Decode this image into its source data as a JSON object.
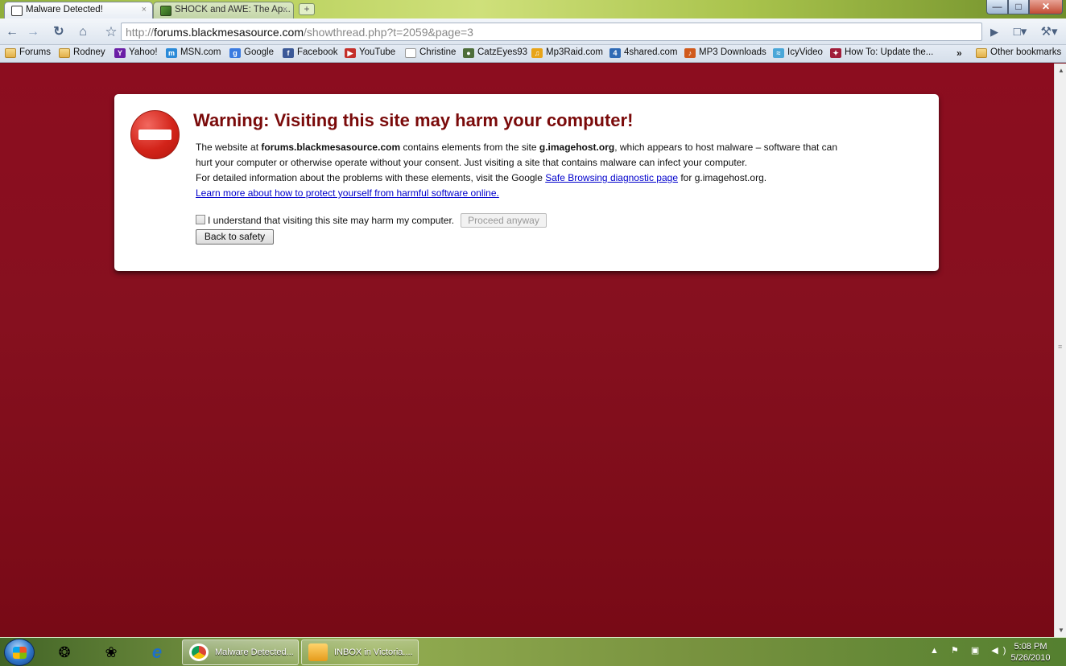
{
  "browser": {
    "tabs": [
      {
        "label": "Malware Detected!",
        "close": "×"
      },
      {
        "label": "SHOCK and AWE: The Ap...",
        "close": "×"
      }
    ],
    "new_tab": "+",
    "window_controls": {
      "minimize": "—",
      "maximize": "□",
      "close": "✕"
    },
    "url": {
      "scheme": "http://",
      "host": "forums.blackmesasource.com",
      "path": "/showthread.php?t=2059&page=3"
    },
    "icons": {
      "back": "back-arrow-icon",
      "forward": "forward-arrow-icon",
      "reload": "reload-icon",
      "home": "home-icon",
      "star": "star-icon",
      "go": "go-play-icon",
      "page": "page-menu-icon",
      "wrench": "wrench-icon"
    }
  },
  "bookmarks": [
    {
      "label": "Forums",
      "icon": "folder-icon"
    },
    {
      "label": "Rodney",
      "icon": "folder-icon"
    },
    {
      "label": "Yahoo!",
      "icon": "yahoo-icon"
    },
    {
      "label": "MSN.com",
      "icon": "msn-icon"
    },
    {
      "label": "Google",
      "icon": "google-icon"
    },
    {
      "label": "Facebook",
      "icon": "facebook-icon"
    },
    {
      "label": "YouTube",
      "icon": "youtube-icon"
    },
    {
      "label": "Christine",
      "icon": "page-icon"
    },
    {
      "label": "CatzEyes93",
      "icon": "cat-icon"
    },
    {
      "label": "Mp3Raid.com",
      "icon": "music-icon"
    },
    {
      "label": "4shared.com",
      "icon": "4shared-icon"
    },
    {
      "label": "MP3 Downloads",
      "icon": "mp3-icon"
    },
    {
      "label": "IcyVideo",
      "icon": "icyvideo-icon"
    },
    {
      "label": "How To: Update the...",
      "icon": "howto-icon"
    }
  ],
  "bookmarks_overflow": "»",
  "other_bookmarks": "Other bookmarks",
  "warning": {
    "title": "Warning: Visiting this site may harm your computer!",
    "line1_a": "The website at ",
    "line1_site": "forums.blackmesasource.com",
    "line1_b": " contains elements from the site ",
    "line1_host": "g.imagehost.org",
    "line1_c": ", which appears to host malware – software that can",
    "line2": "hurt your computer or otherwise operate without your consent. Just visiting a site that contains malware can infect your computer.",
    "line3_a": "For detailed information about the problems with these elements, visit the Google ",
    "line3_link": "Safe Browsing diagnostic page",
    "line3_b": " for g.imagehost.org.",
    "learn_more": "Learn more about how to protect yourself from harmful software online.",
    "checkbox_label": "I understand that visiting this site may harm my computer.",
    "proceed": "Proceed anyway",
    "back_to_safety": "Back to safety"
  },
  "taskbar": {
    "tasks": [
      {
        "label": "Malware Detected..."
      },
      {
        "label": "INBOX in Victoria...."
      }
    ],
    "tray": "▲ ⚑ ▣ ◀)",
    "time": "5:08 PM",
    "date": "5/26/2010"
  },
  "colors": {
    "page_background": "#86101f",
    "title_red": "#7a0a0a",
    "link_blue": "#0000cc"
  }
}
